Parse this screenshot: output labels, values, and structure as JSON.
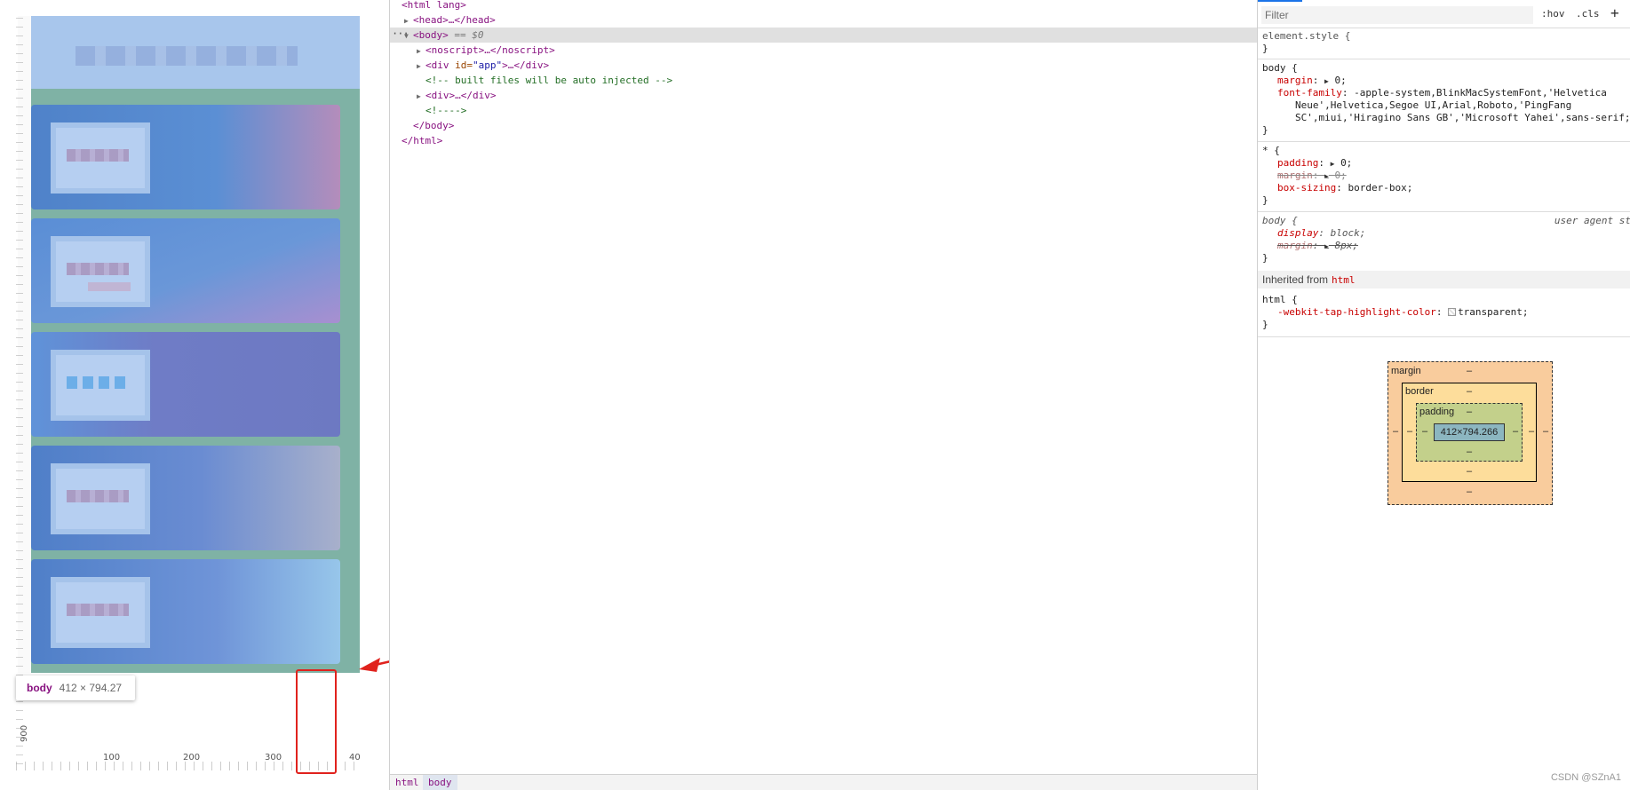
{
  "preview": {
    "tooltip": {
      "tag": "body",
      "size": "412 × 794.27"
    },
    "ruler": {
      "x_ticks": [
        "100",
        "200",
        "300",
        "40"
      ],
      "y_tick": "900"
    },
    "colors": {
      "annotation_red": "#e0221d"
    }
  },
  "elements": {
    "lines": {
      "html_open": "<html lang>",
      "head": "<head>…</head>",
      "body_open": "<body>",
      "body_eq": "== $0",
      "noscript": "<noscript>…</noscript>",
      "div_app_open": "<div ",
      "div_app_attr": "id=",
      "div_app_value": "\"app\"",
      "div_app_close": ">…</div>",
      "comment_injected": "<!-- built files will be auto injected -->",
      "div_plain": "<div>…</div>",
      "comment_empty": "<!---->",
      "body_close": "</body>",
      "html_close": "</html>"
    },
    "dots": "···",
    "breadcrumbs": [
      "html",
      "body"
    ]
  },
  "styles": {
    "filter_placeholder": "Filter",
    "toolbar": {
      "hov": ":hov",
      "cls": ".cls",
      "add": "+"
    },
    "element_style": {
      "selector": "element.style {",
      "close": "}"
    },
    "rule_body": {
      "selector": "body {",
      "margin_prop": "margin",
      "margin_val": "0;",
      "font_prop": "font-family",
      "font_val_1": "-apple-system,BlinkMacSystemFont,'Helvetica",
      "font_val_2": "Neue',Helvetica,Segoe UI,Arial,Roboto,'PingFang",
      "font_val_3": "SC',miui,'Hiragino Sans GB','Microsoft Yahei',sans-serif;",
      "close": "}"
    },
    "rule_star": {
      "selector": "* {",
      "padding_prop": "padding",
      "padding_val": "0;",
      "margin_prop": "margin",
      "margin_val": "0;",
      "boxsizing_prop": "box-sizing",
      "boxsizing_val": "border-box;",
      "close": "}"
    },
    "rule_ua": {
      "selector": "body {",
      "source": "user agent st",
      "display_prop": "display",
      "display_val": "block;",
      "margin_prop": "margin",
      "margin_val": "8px;",
      "close": "}"
    },
    "inherited": {
      "label": "Inherited from",
      "tag": "html"
    },
    "rule_html": {
      "selector": "html {",
      "prop": "-webkit-tap-highlight-color",
      "val": "transparent;",
      "close": "}"
    },
    "box_model": {
      "margin_label": "margin",
      "border_label": "border",
      "padding_label": "padding",
      "content_size": "412×794.266",
      "dash": "–"
    }
  },
  "watermark": "CSDN @SZnA1"
}
